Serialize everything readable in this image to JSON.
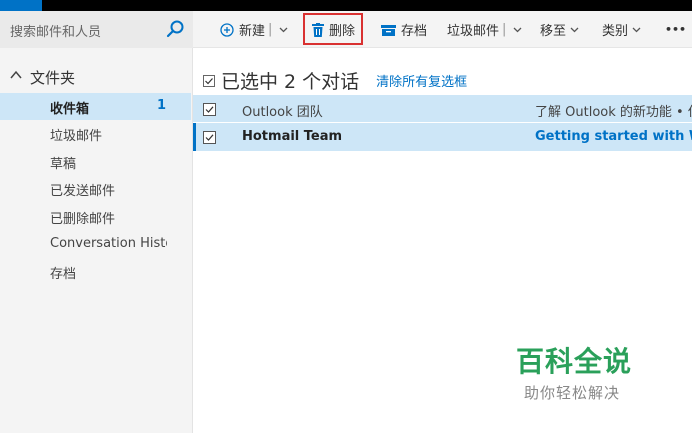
{
  "search": {
    "placeholder": "搜索邮件和人员",
    "icon": "search-icon"
  },
  "sidebar": {
    "folder_header": "文件夹",
    "items": [
      {
        "label": "收件箱",
        "count": "1",
        "selected": true
      },
      {
        "label": "垃圾邮件"
      },
      {
        "label": "草稿"
      },
      {
        "label": "已发送邮件"
      },
      {
        "label": "已删除邮件"
      },
      {
        "label": "Conversation History"
      },
      {
        "label": "存档"
      }
    ]
  },
  "toolbar": {
    "new_label": "新建",
    "delete_label": "删除",
    "archive_label": "存档",
    "junk_label": "垃圾邮件",
    "move_label": "移至",
    "category_label": "类别",
    "more_label": "•••"
  },
  "main": {
    "selection_title": "已选中 2 个对话",
    "clear_selection": "清除所有复选框",
    "messages": [
      {
        "sender": "Outlook 团队",
        "subject": "了解 Outlook 的新功能 • 但",
        "unread": false,
        "checked": true
      },
      {
        "sender": "Hotmail Team",
        "subject": "Getting started with Win",
        "unread": true,
        "checked": true
      }
    ]
  },
  "watermark": {
    "title": "百科全说",
    "subtitle": "助你轻松解决"
  },
  "colors": {
    "accent": "#0072c6",
    "selection": "#cde6f7",
    "highlight_border": "#d93131",
    "watermark_green": "#2aa05a"
  }
}
